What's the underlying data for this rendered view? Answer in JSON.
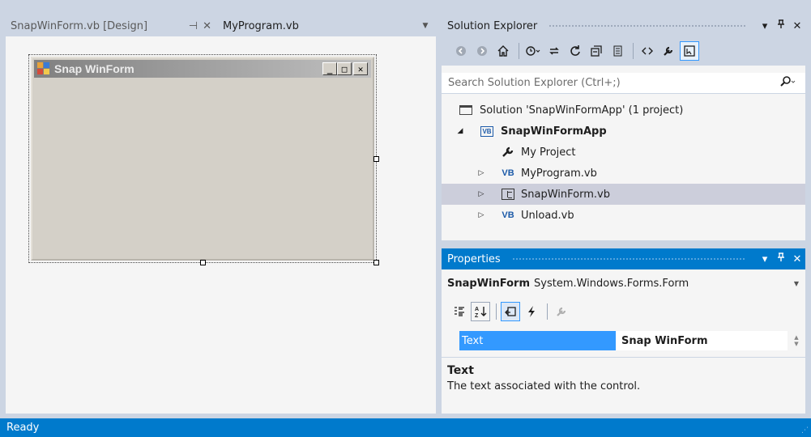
{
  "tabs": {
    "design_tab_label": "SnapWinForm.vb [Design]",
    "pin_glyph": "⊣",
    "close_glyph": "✕",
    "program_tab_label": "MyProgram.vb",
    "dropdown_glyph": "▼"
  },
  "designer": {
    "form_title": "Snap WinForm",
    "minimize_glyph": "_",
    "maximize_glyph": "□",
    "close_glyph": "✕"
  },
  "solution_explorer": {
    "title": "Solution Explorer",
    "title_buttons": {
      "menu": "▾",
      "pin": "ᵽ",
      "close": "✕"
    },
    "toolbar_icons": [
      "back-icon",
      "forward-icon",
      "home-icon",
      "history-icon",
      "sync-icon",
      "refresh-icon",
      "collapse-all-icon",
      "show-all-files-icon",
      "view-code-icon",
      "properties-icon",
      "preview-icon"
    ],
    "search_placeholder": "Search Solution Explorer (Ctrl+;)",
    "tree": [
      {
        "label": "Solution 'SnapWinFormApp' (1 project)",
        "icon": "solution-icon",
        "level": 0,
        "expander": ""
      },
      {
        "label": "SnapWinFormApp",
        "icon": "vb-project-icon",
        "level": 0,
        "expander": "◢",
        "bold": true
      },
      {
        "label": "My Project",
        "icon": "wrench-icon",
        "level": 1,
        "expander": ""
      },
      {
        "label": "MyProgram.vb",
        "icon": "vb-file-icon",
        "level": 1,
        "expander": "▷"
      },
      {
        "label": "SnapWinForm.vb",
        "icon": "form-icon",
        "level": 1,
        "expander": "▷",
        "selected": true
      },
      {
        "label": "Unload.vb",
        "icon": "vb-file-icon",
        "level": 1,
        "expander": "▷"
      }
    ],
    "vb_badge": "VB"
  },
  "properties": {
    "title": "Properties",
    "title_buttons": {
      "menu": "▾",
      "pin": "ᵽ",
      "close": "✕"
    },
    "object_name": "SnapWinForm",
    "object_type": "System.Windows.Forms.Form",
    "selected_property": {
      "name": "Text",
      "value": "Snap WinForm"
    },
    "description_title": "Text",
    "description_text": "The text associated with the control."
  },
  "statusbar": {
    "text": "Ready"
  },
  "colors": {
    "accent": "#007acc",
    "selection": "#3399ff",
    "chrome": "#ccd5e3",
    "tree_selected": "#cccedb"
  }
}
